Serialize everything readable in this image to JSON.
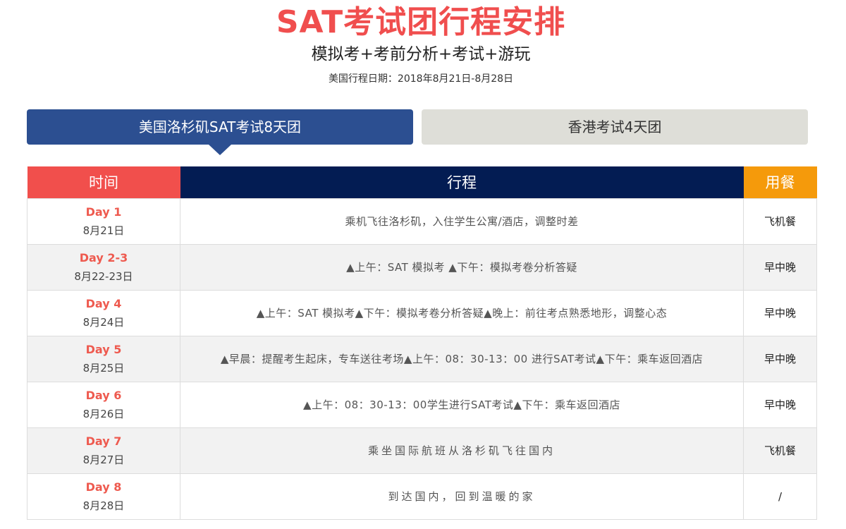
{
  "header": {
    "title": "SAT考试团行程安排",
    "subtitle": "模拟考+考前分析+考试+游玩",
    "dates": "美国行程日期：2018年8月21日-8月28日"
  },
  "tabs": [
    {
      "label": "美国洛杉矶SAT考试8天团",
      "active": true
    },
    {
      "label": "香港考试4天团",
      "active": false
    }
  ],
  "table": {
    "headers": {
      "time": "时间",
      "itinerary": "行程",
      "meal": "用餐"
    },
    "rows": [
      {
        "day": "Day 1",
        "date": "8月21日",
        "itinerary": "乘机飞往洛杉矶，入住学生公寓/酒店，调整时差",
        "meal": "飞机餐"
      },
      {
        "day": "Day 2-3",
        "date": "8月22-23日",
        "itinerary": "▲上午：SAT 模拟考 ▲下午：模拟考卷分析答疑",
        "meal": "早中晚"
      },
      {
        "day": "Day 4",
        "date": "8月24日",
        "itinerary": "▲上午：SAT 模拟考▲下午：模拟考卷分析答疑▲晚上：前往考点熟悉地形，调整心态",
        "meal": "早中晚"
      },
      {
        "day": "Day 5",
        "date": "8月25日",
        "itinerary": "▲早晨：提醒考生起床，专车送往考场▲上午：08：30-13：00 进行SAT考试▲下午：乘车返回酒店",
        "meal": "早中晚"
      },
      {
        "day": "Day 6",
        "date": "8月26日",
        "itinerary": "▲上午：08：30-13：00学生进行SAT考试▲下午：乘车返回酒店",
        "meal": "早中晚"
      },
      {
        "day": "Day 7",
        "date": "8月27日",
        "itinerary": "乘坐国际航班从洛杉矶飞往国内",
        "meal": "飞机餐"
      },
      {
        "day": "Day 8",
        "date": "8月28日",
        "itinerary": "到达国内，回到温暖的家",
        "meal": "/"
      }
    ]
  },
  "colors": {
    "title": "#f04e4e",
    "tab_active": "#2c4f91",
    "tab_inactive": "#deded8",
    "header_time": "#f14f4c",
    "header_itinerary": "#031c53",
    "header_meal": "#f59a0b",
    "day_label": "#ee5a4f"
  }
}
